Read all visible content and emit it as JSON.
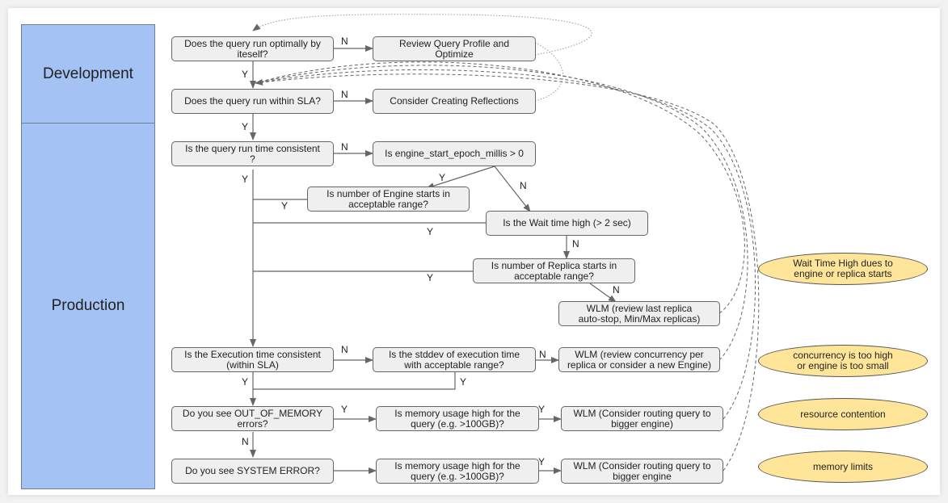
{
  "lanes": {
    "development": "Development",
    "production": "Production"
  },
  "nodes": {
    "q_optimal": "Does the query run optimally by\niteself?",
    "review_profile": "Review Query Profile and\nOptimize",
    "q_sla": "Does the query run within SLA?",
    "reflections": "Consider Creating Reflections",
    "q_runtime_consistent": "Is  the query run time consistent\n?",
    "engine_start": "Is engine_start_epoch_millis > 0",
    "engine_starts_range": "Is number of Engine starts in\nacceptable  range?",
    "wait_time": "Is the Wait time high (> 2 sec)",
    "replica_starts_range": "Is number of Replica starts in\nacceptable  range?",
    "wlm_replica": "WLM (review last replica\nauto-stop, Min/Max replicas)",
    "q_exec_consistent": "Is the Execution time consistent\n(within SLA)",
    "stddev": "Is the stddev of execution time\nwith acceptable range?",
    "wlm_concurrency": "WLM (review concurrency per\nreplica or consider a new Engine)",
    "q_oom": "Do you see OUT_OF_MEMORY\nerrors?",
    "mem_high_1": "Is memory usage high for the\nquery (e.g. >100GB)?",
    "wlm_route_1": "WLM (Consider routing query to\nbigger engine)",
    "q_system_error": "Do you see SYSTEM ERROR?",
    "mem_high_2": "Is memory usage high for the\nquery (e.g. >100GB)?",
    "wlm_route_2": "WLM (Consider routing query to\nbigger engine"
  },
  "causes": {
    "wait_time": "Wait Time High dues to\nengine or  replica starts",
    "concurrency": "concurrency is too high\nor engine is too small",
    "contention": "resource contention",
    "memory": "memory limits"
  },
  "edge_labels": {
    "yes": "Y",
    "no": "N"
  },
  "colors": {
    "lane_fill": "#a4c2f4",
    "node_fill": "#efefef",
    "cause_fill": "#ffe599",
    "line": "#666666"
  }
}
